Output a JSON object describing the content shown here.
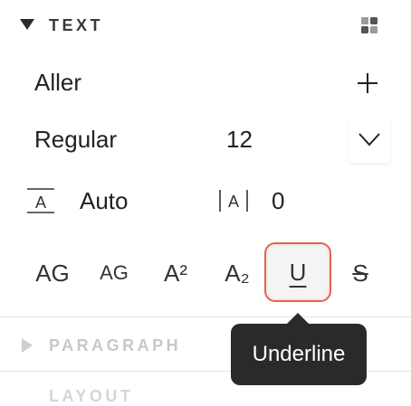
{
  "section": {
    "title": "TEXT",
    "icon": "grid-icon"
  },
  "font": {
    "family": "Aller",
    "weight": "Regular",
    "size": "12"
  },
  "spacing": {
    "line_height": "Auto",
    "letter_spacing": "0"
  },
  "format_buttons": [
    {
      "name": "all-caps-button",
      "label": "AG"
    },
    {
      "name": "small-caps-button",
      "label": "AG"
    },
    {
      "name": "superscript-button",
      "label": "A²"
    },
    {
      "name": "subscript-button",
      "label": "A₂"
    },
    {
      "name": "underline-button",
      "label": "U"
    },
    {
      "name": "strikethrough-button",
      "label": "S"
    }
  ],
  "paragraph": {
    "title": "PARAGRAPH"
  },
  "layout": {
    "title": "LAYOUT"
  },
  "tooltip": {
    "text": "Underline"
  },
  "colors": {
    "accent": "#e0654e",
    "tooltip_bg": "#2a2a2a"
  }
}
